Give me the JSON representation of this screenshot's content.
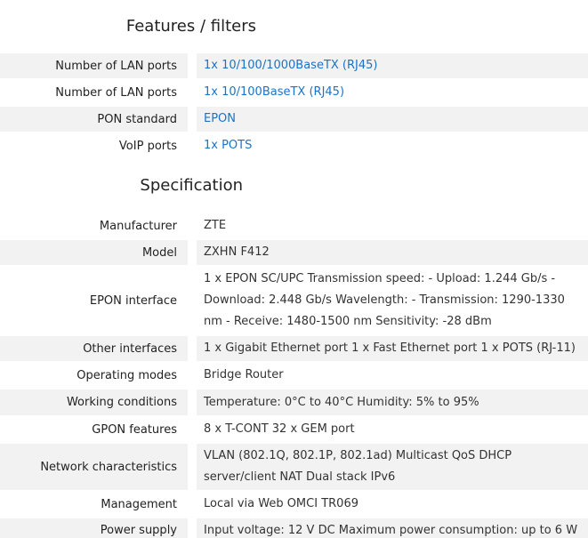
{
  "features": {
    "title": "Features / filters",
    "rows": [
      {
        "label": "Number of LAN ports",
        "value": "1x 10/100/1000BaseTX (RJ45)"
      },
      {
        "label": "Number of LAN ports",
        "value": "1x 10/100BaseTX (RJ45)"
      },
      {
        "label": "PON standard",
        "value": "EPON"
      },
      {
        "label": "VoIP ports",
        "value": "1x POTS"
      }
    ]
  },
  "specification": {
    "title": "Specification",
    "rows": [
      {
        "label": "Manufacturer",
        "value": "ZTE"
      },
      {
        "label": "Model",
        "value": "ZXHN F412"
      },
      {
        "label": "EPON interface",
        "value": "1 x EPON SC/UPC Transmission speed: - Upload: 1.244 Gb/s - Download: 2.448 Gb/s Wavelength: - Transmission: 1290-1330 nm - Receive: 1480-1500 nm Sensitivity: -28 dBm"
      },
      {
        "label": "Other interfaces",
        "value": "1 x Gigabit Ethernet port 1 x Fast Ethernet port 1 x POTS (RJ-11)"
      },
      {
        "label": "Operating modes",
        "value": "Bridge Router"
      },
      {
        "label": "Working conditions",
        "value": "Temperature: 0°C to 40°C Humidity: 5% to 95%"
      },
      {
        "label": "GPON features",
        "value": "8 x T-CONT 32 x GEM port"
      },
      {
        "label": "Network characteristics",
        "value": "VLAN (802.1Q, 802.1P, 802.1ad) Multicast QoS DHCP server/client NAT Dual stack IPv6"
      },
      {
        "label": "Management",
        "value": "Local via Web OMCI TR069"
      },
      {
        "label": "Power supply",
        "value": "Input voltage: 12 V DC Maximum power consumption: up to 6 W"
      }
    ]
  }
}
